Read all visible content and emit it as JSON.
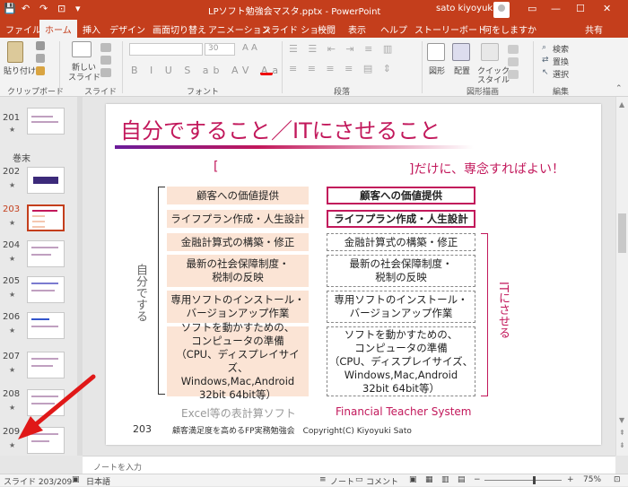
{
  "titlebar": {
    "document": "LPソフト勉強会マスタ.pptx  -  PowerPoint",
    "user": "sato kiyoyuki",
    "qat": [
      "💾",
      "↶",
      "↷",
      "⊡",
      "▾"
    ],
    "window_buttons": [
      "▭",
      "—",
      "☐",
      "✕"
    ]
  },
  "tabs": [
    "ファイル",
    "ホーム",
    "挿入",
    "デザイン",
    "画面切り替え",
    "アニメーション",
    "スライド ショー",
    "校閲",
    "表示",
    "ヘルプ",
    "ストーリーボード",
    "何をしますか",
    "共有"
  ],
  "ribbon": {
    "clipboard": {
      "paste": "貼り付け",
      "label": "クリップボード"
    },
    "slides": {
      "new_slide": "新しい",
      "new_slide2": "スライド",
      "label": "スライド"
    },
    "font": {
      "size": "30",
      "label": "フォント"
    },
    "paragraph": {
      "label": "段落"
    },
    "drawing": {
      "shape": "図形",
      "arrange": "配置",
      "quick": "クイック",
      "style": "スタイル",
      "label": "図形描画"
    },
    "editing": {
      "find": "検索",
      "replace": "置換",
      "select": "選択",
      "label": "編集"
    }
  },
  "thumbnails": [
    {
      "num": "201",
      "star": "★"
    },
    {
      "section": "巻末"
    },
    {
      "num": "202",
      "star": "★"
    },
    {
      "num": "203",
      "star": "★",
      "selected": true
    },
    {
      "num": "204",
      "star": "★"
    },
    {
      "num": "205",
      "star": "★"
    },
    {
      "num": "206",
      "star": "★"
    },
    {
      "num": "207",
      "star": "★"
    },
    {
      "num": "208",
      "star": "★"
    },
    {
      "num": "209",
      "star": "★"
    }
  ],
  "slide": {
    "title": "自分ですること／ITにさせること",
    "bracket_open": "[",
    "bracket_close": "]だけに、専念すればよい！",
    "left_vertical": "自分でする",
    "right_vertical": "ITにさせる",
    "left_items": [
      "顧客への価値提供",
      "ライフプラン作成・人生設計",
      "金融計算式の構築・修正",
      "最新の社会保障制度・\n税制の反映",
      "専用ソフトのインストール・\nバージョンアップ作業",
      "ソフトを動かすための、\nコンピュータの準備\n（CPU、ディスプレイサイズ、\nWindows,Mac,Android\n32bit 64bit等）"
    ],
    "right_items": [
      "顧客への価値提供",
      "ライフプラン作成・人生設計",
      "金融計算式の構築・修正",
      "最新の社会保障制度・\n税制の反映",
      "専用ソフトのインストール・\nバージョンアップ作業",
      "ソフトを動かすための、\nコンピュータの準備\n（CPU、ディスプレイサイズ、\nWindows,Mac,Android\n32bit 64bit等）"
    ],
    "left_caption": "Excel等の表計算ソフト",
    "right_caption": "Financial Teacher System",
    "page_number": "203",
    "footer": "顧客満足度を高めるFP実務勉強会　Copyright(C) Kiyoyuki Sato"
  },
  "notes_placeholder": "ノートを入力",
  "status": {
    "slide": "スライド 203/209",
    "lang": "日本語",
    "notes": "ノート",
    "comments": "コメント",
    "zoom": "75%"
  },
  "colors": {
    "accent": "#c43e1c",
    "title": "#c2185b",
    "lbox": "#fbe4d5"
  }
}
